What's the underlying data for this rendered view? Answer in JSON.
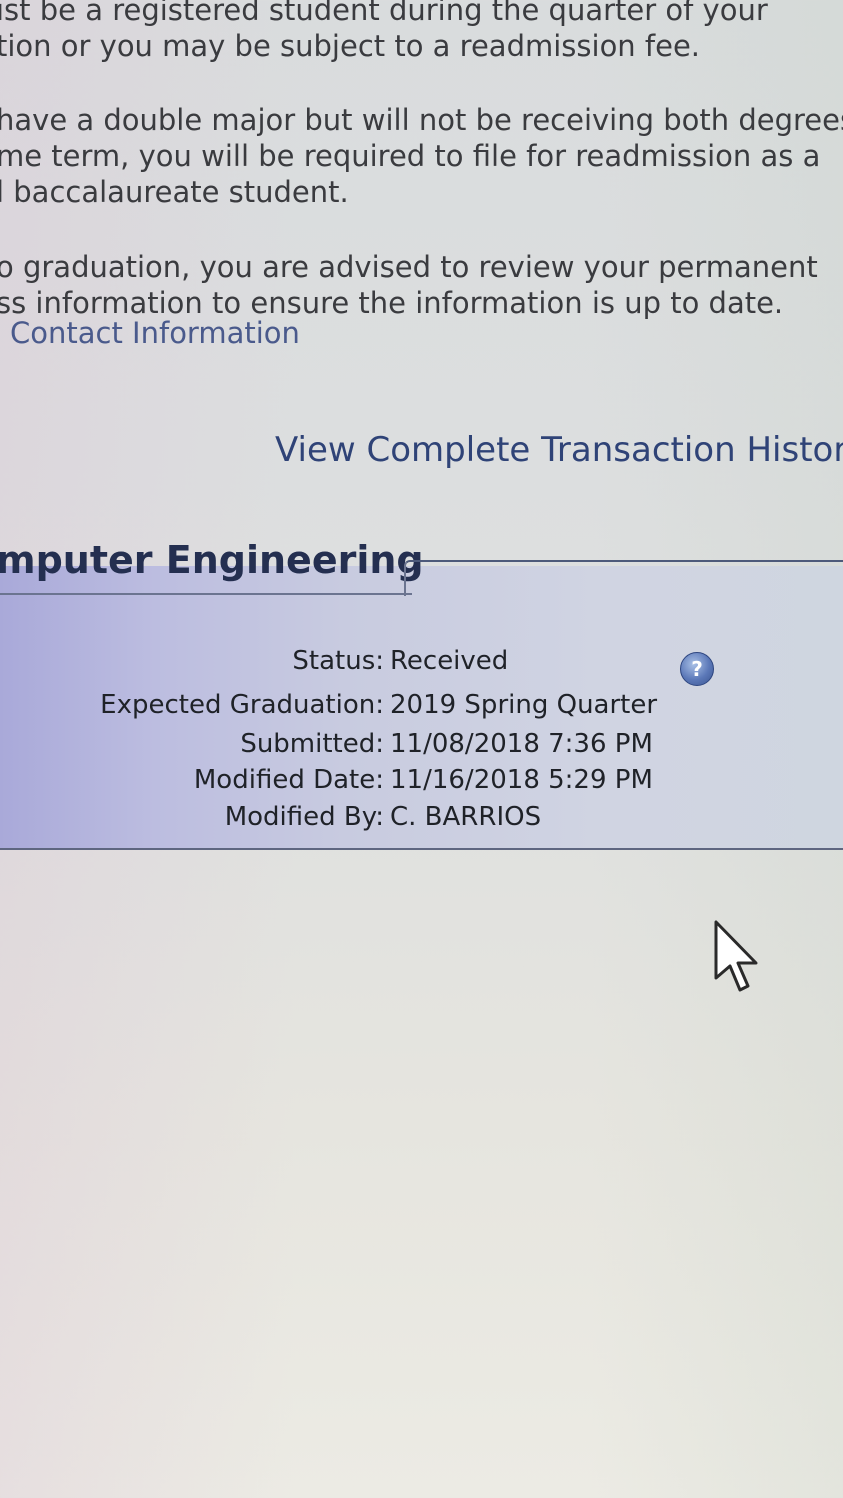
{
  "notice": {
    "paragraphs": [
      [
        "ıst be a registered student during the quarter of your",
        "tion or you may be subject to a readmission fee."
      ],
      [
        "have a double major but will not be receiving both degrees",
        "me term, you will be required to file for readmission as a",
        "l baccalaureate student."
      ],
      [
        "o graduation, you are advised to review your permanent",
        "ss information to ensure the information is up to date."
      ]
    ],
    "contact_link": "Contact Information"
  },
  "history_link": "View Complete Transaction History",
  "section": {
    "title": "mputer Engineering"
  },
  "status": {
    "rows": [
      {
        "label": "Status:",
        "value": "Received"
      },
      {
        "label": "Expected Graduation:",
        "value": "2019 Spring Quarter"
      },
      {
        "label": "Submitted:",
        "value": "11/08/2018 7:36 PM"
      },
      {
        "label": "Modified Date:",
        "value": "11/16/2018 5:29 PM"
      },
      {
        "label": "Modified By:",
        "value": "C. BARRIOS"
      }
    ],
    "help_icon": "help-icon",
    "help_glyph": "?",
    "accent_color": "#5b78b8"
  },
  "pointer": "arrow-cursor-icon"
}
